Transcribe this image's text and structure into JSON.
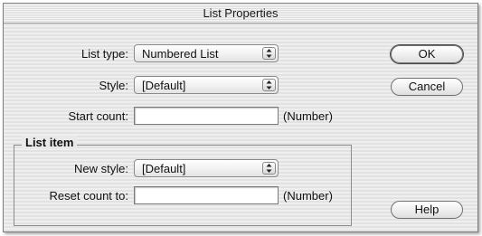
{
  "window": {
    "title": "List Properties"
  },
  "form": {
    "list_type": {
      "label": "List type:",
      "value": "Numbered List"
    },
    "style": {
      "label": "Style:",
      "value": "[Default]"
    },
    "start_count": {
      "label": "Start count:",
      "value": "",
      "hint": "(Number)"
    }
  },
  "list_item": {
    "title": "List item",
    "new_style": {
      "label": "New style:",
      "value": "[Default]"
    },
    "reset_count": {
      "label": "Reset count to:",
      "value": "",
      "hint": "(Number)"
    }
  },
  "buttons": {
    "ok": "OK",
    "cancel": "Cancel",
    "help": "Help"
  },
  "icons": {
    "select_arrows": "updown-arrows-icon"
  }
}
